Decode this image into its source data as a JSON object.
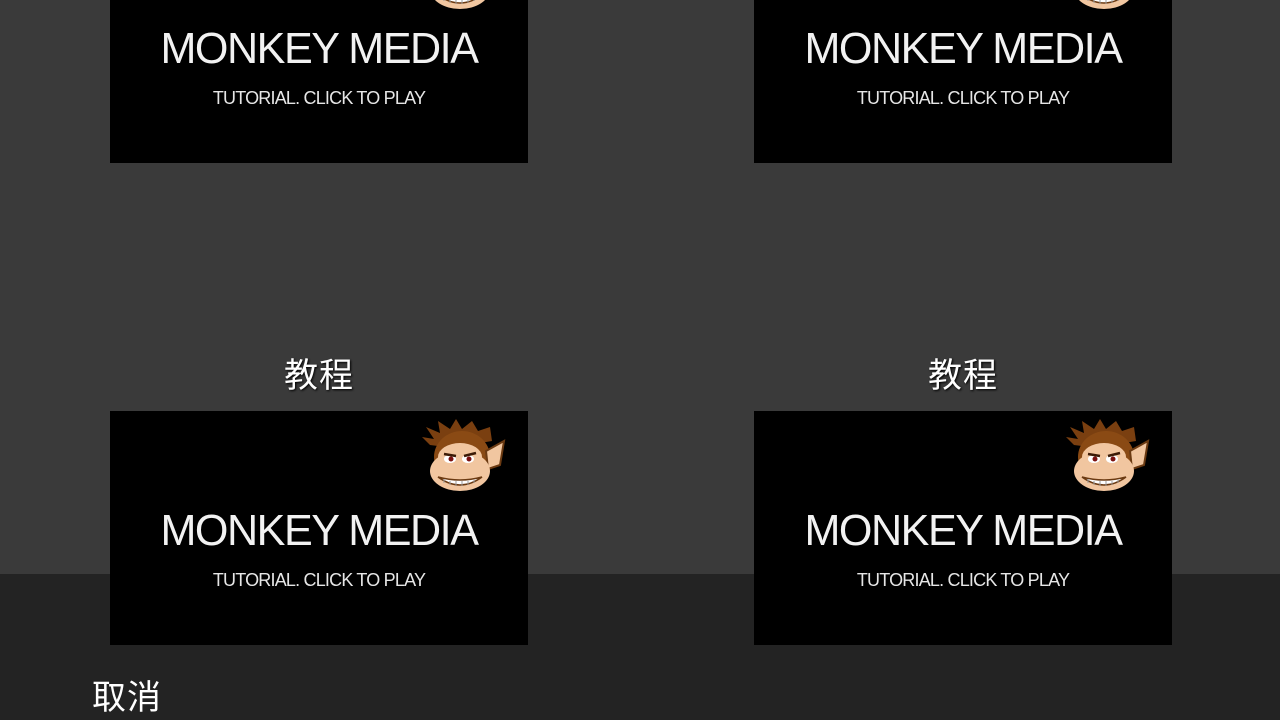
{
  "dialog": {
    "tiles": [
      {
        "caption": "",
        "title": "MONKEY MEDIA",
        "subtitle": "TUTORIAL. CLICK TO PLAY",
        "icon": "monkey-face-icon"
      },
      {
        "caption": "",
        "title": "MONKEY MEDIA",
        "subtitle": "TUTORIAL. CLICK TO PLAY",
        "icon": "monkey-face-icon"
      },
      {
        "caption": "教程",
        "title": "MONKEY MEDIA",
        "subtitle": "TUTORIAL. CLICK TO PLAY",
        "icon": "monkey-face-icon"
      },
      {
        "caption": "教程",
        "title": "MONKEY MEDIA",
        "subtitle": "TUTORIAL. CLICK TO PLAY",
        "icon": "monkey-face-icon"
      }
    ],
    "cancel_label": "取消"
  },
  "colors": {
    "background": "#3a3a3a",
    "bottom_bar": "#232323",
    "tile_background": "#000000",
    "text": "#ffffff"
  }
}
